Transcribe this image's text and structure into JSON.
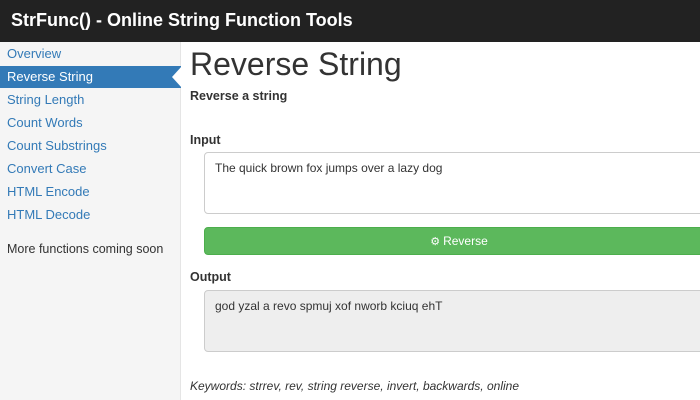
{
  "header": {
    "title": "StrFunc() - Online String Function Tools"
  },
  "sidebar": {
    "items": [
      {
        "label": "Overview",
        "active": false
      },
      {
        "label": "Reverse String",
        "active": true
      },
      {
        "label": "String Length",
        "active": false
      },
      {
        "label": "Count Words",
        "active": false
      },
      {
        "label": "Count Substrings",
        "active": false
      },
      {
        "label": "Convert Case",
        "active": false
      },
      {
        "label": "HTML Encode",
        "active": false
      },
      {
        "label": "HTML Decode",
        "active": false
      }
    ],
    "note": "More functions coming soon"
  },
  "main": {
    "title": "Reverse String",
    "subtitle": "Reverse a string",
    "input_label": "Input",
    "input_value": "The quick brown fox jumps over a lazy dog",
    "button_label": "Reverse",
    "button_icon": "gears-icon",
    "output_label": "Output",
    "output_value": "god yzal a revo spmuj xof nworb kciuq ehT",
    "keywords": "Keywords: strrev, rev, string reverse, invert, backwards, online"
  },
  "colors": {
    "navbar": "#222222",
    "link": "#337ab7",
    "active_bg": "#337ab7",
    "button": "#5cb85c"
  }
}
